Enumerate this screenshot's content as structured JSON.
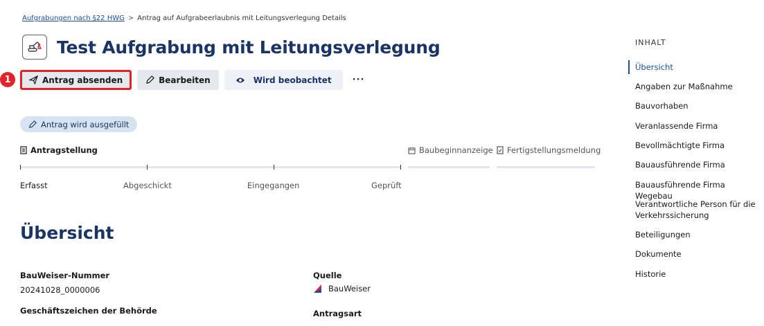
{
  "breadcrumb": {
    "parent": "Aufgrabungen nach §22 HWG",
    "separator": ">",
    "current": "Antrag auf Aufgrabeerlaubnis mit Leitungsverlegung Details"
  },
  "page": {
    "title": "Test Aufgrabung mit Leitungsverlegung",
    "icon": "excavator-icon"
  },
  "actions": {
    "submit": "Antrag absenden",
    "edit": "Bearbeiten",
    "watch": "Wird beobachtet",
    "more": "···"
  },
  "marker": {
    "number": "1",
    "color": "#e2232a"
  },
  "status": {
    "label": "Antrag wird ausgefüllt",
    "color": "#d6e4f2"
  },
  "progress": {
    "stages": [
      {
        "label": "Antragstellung",
        "icon": "document-icon",
        "active": true
      },
      {
        "label": "Baubeginnanzeige",
        "icon": "calendar-icon",
        "active": false
      },
      {
        "label": "Fertigstellungsmeldung",
        "icon": "checked-document-icon",
        "active": false
      }
    ],
    "steps": [
      "Erfasst",
      "Abgeschickt",
      "Eingegangen",
      "Geprüft"
    ]
  },
  "overview": {
    "title": "Übersicht",
    "fields": {
      "bauweiser_label": "BauWeiser-Nummer",
      "bauweiser_value": "20241028_0000006",
      "geschaeft_label": "Geschäftszeichen der Behörde",
      "quelle_label": "Quelle",
      "quelle_value": "BauWeiser",
      "antragsart_label": "Antragsart"
    }
  },
  "toc": {
    "heading": "INHALT",
    "items": [
      "Übersicht",
      "Angaben zur Maßnahme",
      "Bauvorhaben",
      "Veranlassende Firma",
      "Bevollmächtigte Firma",
      "Bauausführende Firma",
      "Bauausführende Firma Wegebau",
      "Verantwortliche Person für die Verkehrssicherung",
      "Beteiligungen",
      "Dokumente",
      "Historie"
    ],
    "active_index": 0
  },
  "colors": {
    "brand_blue": "#1a3565",
    "link_blue": "#1b4e9b",
    "highlight_red": "#e2232a"
  }
}
